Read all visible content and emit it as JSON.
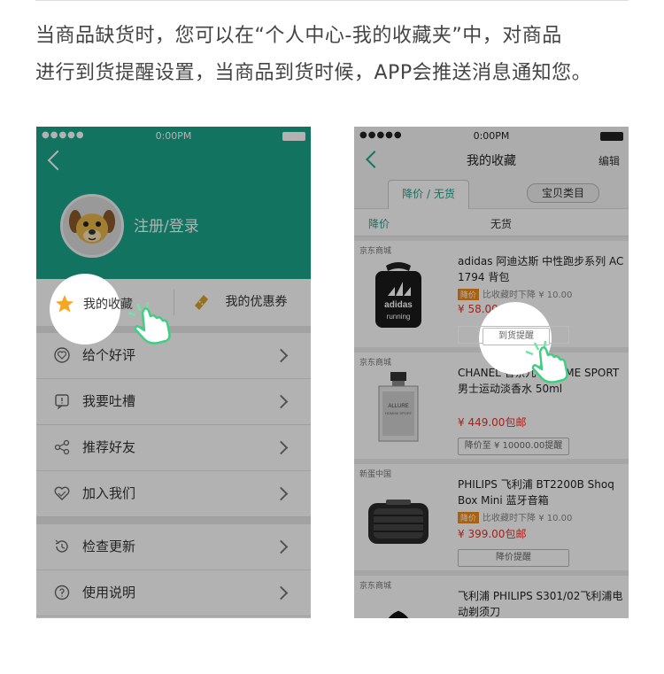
{
  "intro": {
    "line1": "当商品缺货时，您可以在“个人中心-我的收藏夹”中，对商品",
    "line2": "进行到货提醒设置，当商品到货时候，APP会推送消息通知您。"
  },
  "left_phone": {
    "status": {
      "signal_dots": "●●●●●",
      "time": "0:00PM"
    },
    "login_text": "注册/登录",
    "quick": {
      "favorites_label": "我的收藏",
      "coupons_label": "我的优惠券"
    },
    "menu_group1": [
      {
        "label": "给个好评",
        "icon": "heart-chat-icon"
      },
      {
        "label": "我要吐槽",
        "icon": "complain-icon"
      },
      {
        "label": "推荐好友",
        "icon": "share-icon"
      },
      {
        "label": "加入我们",
        "icon": "handshake-icon"
      }
    ],
    "menu_group2": [
      {
        "label": "检查更新",
        "icon": "update-icon"
      },
      {
        "label": "使用说明",
        "icon": "help-icon"
      }
    ],
    "colors": {
      "header": "#1aa58c",
      "star": "#f5a623",
      "coupon": "#d9a22b"
    }
  },
  "right_phone": {
    "status": {
      "signal_dots": "●●●●●",
      "time": "0:00PM"
    },
    "title": "我的收藏",
    "edit": "编辑",
    "tabs": {
      "tab1": "降价 / 无货",
      "tab2": "宝贝类目"
    },
    "filters": {
      "f1": "降价",
      "f2": "无货"
    },
    "products": [
      {
        "shop": "京东商城",
        "name": "adidas 阿迪达斯 中性跑步系列 AC1794 背包",
        "drop_badge": "降价",
        "drop_text": "比收藏时下降 ¥ 10.00",
        "price": "¥ 58.00",
        "button": "到货提醒"
      },
      {
        "shop": "京东商城",
        "name": "CHANEL 香奈儿 HOMME SPORT 男士运动淡香水 50ml",
        "price": "¥ 449.00包邮",
        "button": "降价至 ¥ 10000.00提醒"
      },
      {
        "shop": "新蛋中国",
        "name": "PHILIPS 飞利浦 BT2200B Shoq Box Mini 蓝牙音箱",
        "drop_badge": "降价",
        "drop_text": "比收藏时下降 ¥ 10.00",
        "price": "¥ 399.00包邮",
        "button": "降价提醒"
      },
      {
        "shop": "京东商城",
        "name": "飞利浦 PHILIPS S301/02飞利浦电动剃须刀"
      }
    ],
    "image_texts": {
      "adidas_logo": "adidas",
      "adidas_sub": "running",
      "chanel_brand": "ALLURE",
      "chanel_sub": "HOMME SPORT"
    },
    "colors": {
      "accent": "#1aa58c",
      "price": "#e6322a",
      "badge": "#f08c1e"
    }
  }
}
